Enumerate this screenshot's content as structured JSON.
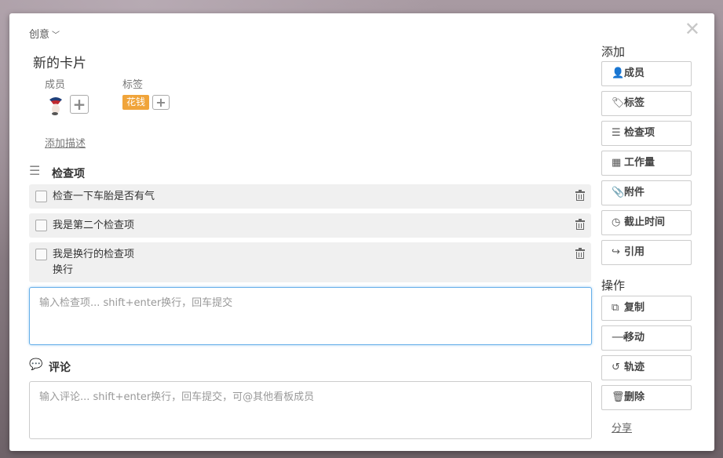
{
  "card": {
    "board_name": "创意",
    "title": "新的卡片",
    "members_label": "成员",
    "labels_label": "标签",
    "label_tag": "花钱",
    "add_description": "添加描述"
  },
  "checklist": {
    "heading": "检查项",
    "items": [
      {
        "text": "检查一下车胎是否有气",
        "checked": false
      },
      {
        "text": "我是第二个检查项",
        "checked": false
      },
      {
        "text": "我是换行的检查项\n换行",
        "checked": false
      }
    ],
    "input_placeholder": "输入检查项... shift+enter换行，回车提交"
  },
  "comments": {
    "heading": "评论",
    "input_placeholder": "输入评论... shift+enter换行，回车提交，可@其他看板成员"
  },
  "sidebar": {
    "add_heading": "添加",
    "add_buttons": [
      "成员",
      "标签",
      "检查项",
      "工作量",
      "附件",
      "截止时间",
      "引用"
    ],
    "actions_heading": "操作",
    "action_buttons": [
      "复制",
      "移动",
      "轨迹",
      "删除"
    ],
    "share": "分享"
  },
  "colors": {
    "label_tag": "#f0a43a",
    "focus_border": "#66afe9"
  }
}
